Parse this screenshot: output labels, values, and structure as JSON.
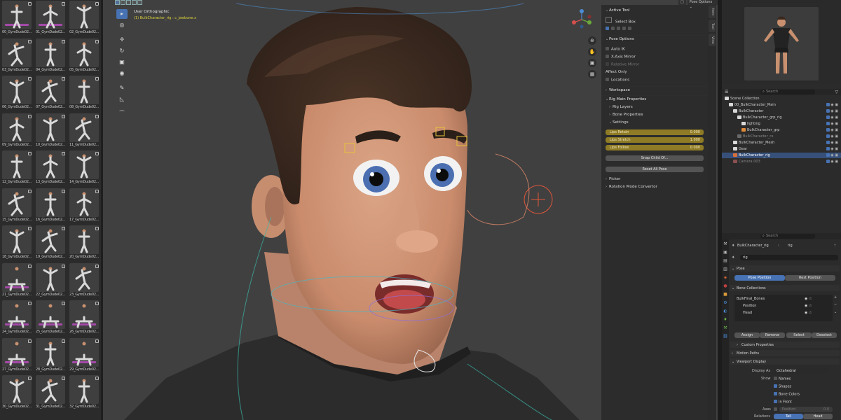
{
  "asset_browser": {
    "items": [
      {
        "label": "00_GymDude02..."
      },
      {
        "label": "01_GymDude02..."
      },
      {
        "label": "02_GymDude02..."
      },
      {
        "label": "03_GymDude02..."
      },
      {
        "label": "04_GymDude02..."
      },
      {
        "label": "05_GymDude02..."
      },
      {
        "label": "06_GymDude02..."
      },
      {
        "label": "07_GymDude02..."
      },
      {
        "label": "08_GymDude02..."
      },
      {
        "label": "09_GymDude02..."
      },
      {
        "label": "10_GymDude02..."
      },
      {
        "label": "11_GymDude02..."
      },
      {
        "label": "12_GymDude02..."
      },
      {
        "label": "13_GymDude02..."
      },
      {
        "label": "14_GymDude02..."
      },
      {
        "label": "15_GymDude02..."
      },
      {
        "label": "16_GymDude02..."
      },
      {
        "label": "17_GymDude02..."
      },
      {
        "label": "18_GymDude02..."
      },
      {
        "label": "19_GymDude02..."
      },
      {
        "label": "20_GymDude02..."
      },
      {
        "label": "21_GymDude02..."
      },
      {
        "label": "22_GymDude02..."
      },
      {
        "label": "23_GymDude02..."
      },
      {
        "label": "24_GymDude02..."
      },
      {
        "label": "25_GymDude02..."
      },
      {
        "label": "26_GymDude02..."
      },
      {
        "label": "27_GymDude02..."
      },
      {
        "label": "28_GymDude02..."
      },
      {
        "label": "29_GymDude02..."
      },
      {
        "label": "30_GymDude02..."
      },
      {
        "label": "31_GymDude02..."
      },
      {
        "label": "32_GymDude02..."
      }
    ]
  },
  "viewport": {
    "view_name": "User Orthographic",
    "active_object": "(1) BulkCharacter_rig : c_jawbone.x",
    "pose_options_label": "Pose Options",
    "colors": {
      "background": "#404040",
      "accent": "#4772b3",
      "active_bone_text": "#ddd23a"
    }
  },
  "npanel": {
    "active_tool_title": "Active Tool",
    "select_box": "Select Box",
    "pose_options_title": "Pose Options",
    "auto_ik": "Auto IK",
    "x_axis_mirror": "X-Axis Mirror",
    "relative_mirror": "Relative Mirror",
    "affect_only": "Affect Only",
    "locations": "Locations",
    "workspace": "Workspace",
    "rig_main_properties": "Rig Main Properties",
    "rig_layers": "Rig Layers",
    "bone_properties": "Bone Properties",
    "settings": "Settings",
    "lips_retain_label": "Lips Retain",
    "lips_retain_value": "0.000",
    "lips_stretch_label": "Lips Stretch",
    "lips_stretch_value": "1.000",
    "lips_follow_label": "Lips Follow",
    "lips_follow_value": "0.000",
    "snap_child_of": "Snap Child Of...",
    "reset_all_pose": "Reset All Pose",
    "picker": "Picker",
    "rotation_mode_convertor": "Rotation Mode Convertor"
  },
  "side_tabs": [
    "Item",
    "Tool",
    "View"
  ],
  "outliner": {
    "search_placeholder": "Search",
    "rows": [
      {
        "label": "Scene Collection"
      },
      {
        "label": "00_BulkCharacter_Main"
      },
      {
        "label": "BulkCharacter"
      },
      {
        "label": "BulkCharacter_grp_rig"
      },
      {
        "label": "lighting"
      },
      {
        "label": "BulkCharacter_grp"
      },
      {
        "label": "BulkCharacter_cs"
      },
      {
        "label": "BulkCharacter_Mesh"
      },
      {
        "label": "Gear"
      },
      {
        "label": "BulkCharacter_rig"
      },
      {
        "label": "Camera.003"
      }
    ]
  },
  "properties": {
    "search_placeholder": "Search",
    "object_name": "BulkCharacter_rig",
    "data_name": "rig",
    "armature_field": "rig",
    "pose_section": "Pose",
    "pose_position": "Pose Position",
    "rest_position": "Rest Position",
    "bone_collections_section": "Bone Collections",
    "bone_collections": [
      {
        "label": "BulkFinal_Bones"
      },
      {
        "label": "Position"
      },
      {
        "label": "Head"
      }
    ],
    "assign": "Assign",
    "remove": "Remove",
    "select": "Select",
    "deselect": "Deselect",
    "custom_properties": "Custom Properties",
    "motion_paths": "Motion Paths",
    "viewport_display": "Viewport Display",
    "display_as_label": "Display As",
    "display_as_value": "Octahedral",
    "show_label": "Show",
    "names": "Names",
    "shapes": "Shapes",
    "bone_colors": "Bone Colors",
    "in_front": "In Front",
    "axes_label": "Axes",
    "axes_position": "Position",
    "axes_value": "0.0",
    "relations_label": "Relations",
    "tail": "Tail",
    "head": "Head"
  }
}
